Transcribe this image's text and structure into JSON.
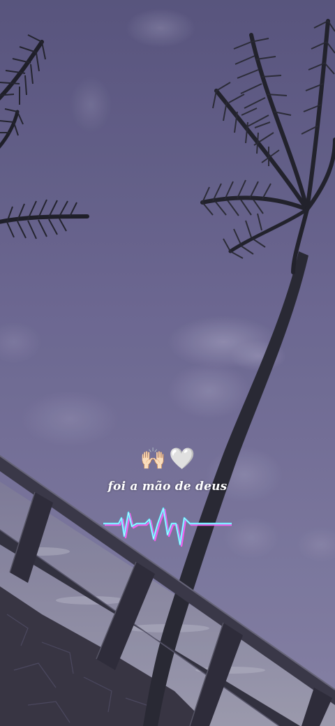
{
  "overlay": {
    "emojis": {
      "hands": "🙌🏻",
      "heart": "🤍"
    },
    "caption": "foi a mão de deus"
  },
  "colors": {
    "sky_top": "#5e5a86",
    "sky_bottom": "#8a86ad",
    "pulse_cyan": "#49e6ff",
    "pulse_magenta": "#ff5df2"
  }
}
